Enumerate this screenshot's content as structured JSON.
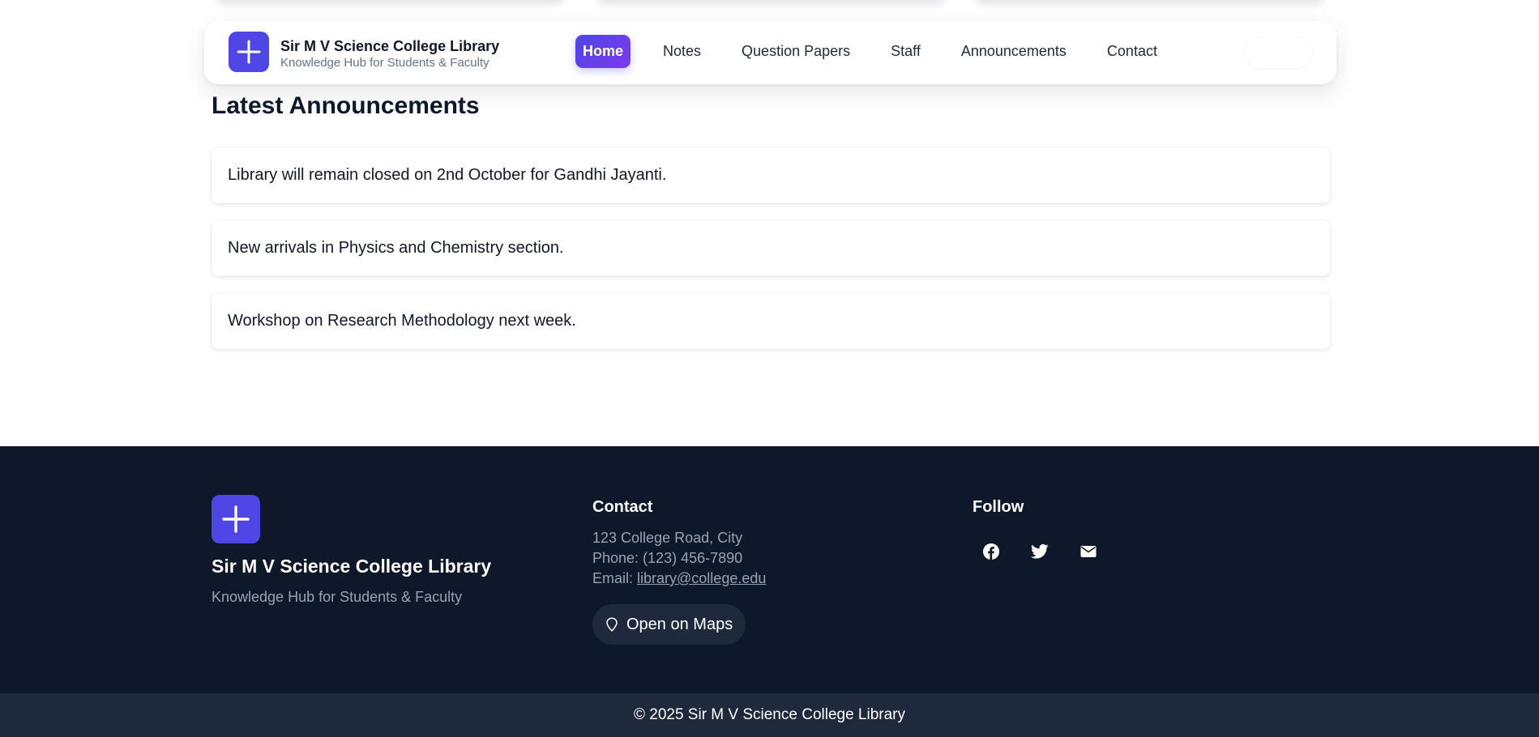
{
  "brand": {
    "title": "Sir M V Science College Library",
    "subtitle": "Knowledge Hub for Students & Faculty",
    "logo_icon": "plus-icon",
    "accent": "#4f46e5"
  },
  "nav": {
    "items": [
      {
        "label": "Home",
        "active": true
      },
      {
        "label": "Notes",
        "active": false
      },
      {
        "label": "Question Papers",
        "active": false
      },
      {
        "label": "Staff",
        "active": false
      },
      {
        "label": "Announcements",
        "active": false
      },
      {
        "label": "Contact",
        "active": false
      }
    ]
  },
  "announcements": {
    "heading": "Latest Announcements",
    "items": [
      "Library will remain closed on 2nd October for Gandhi Jayanti.",
      "New arrivals in Physics and Chemistry section.",
      "Workshop on Research Methodology next week."
    ]
  },
  "footer": {
    "title": "Sir M V Science College Library",
    "subtitle": "Knowledge Hub for Students & Faculty",
    "contact": {
      "heading": "Contact",
      "address": "123 College Road, City",
      "phone": "Phone: (123) 456-7890",
      "email_label": "Email: ",
      "email": "library@college.edu",
      "maps_button": "Open on Maps",
      "maps_icon": "map-pin-icon"
    },
    "follow": {
      "heading": "Follow",
      "icons": [
        "facebook-icon",
        "twitter-icon",
        "mail-icon"
      ]
    },
    "background": "#0f172a",
    "copyright": "© 2025 Sir M V Science College Library"
  }
}
